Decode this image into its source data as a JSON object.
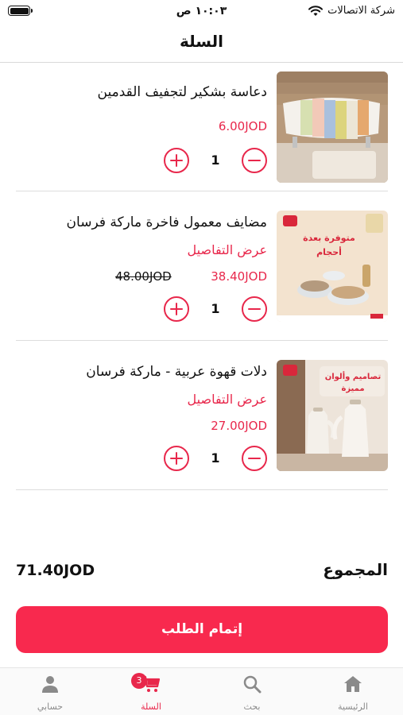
{
  "status_bar": {
    "time": "١٠:٠٣ ص",
    "carrier": "شركة الاتصالات"
  },
  "header": {
    "title": "السلة"
  },
  "cart": {
    "items": [
      {
        "name": "دعاسة بشكير لتجفيف القدمين",
        "price": "6.00JOD",
        "quantity": "1",
        "image": "bath-mat-towels-image"
      },
      {
        "name": "مضايف معمول فاخرة ماركة فرسان",
        "details_label": "عرض التفاصيل",
        "price": "38.40JOD",
        "old_price": "48.00JOD",
        "quantity": "1",
        "image": "maamoul-serving-dishes-image",
        "image_caption_line1": "متوفرة بعدة",
        "image_caption_line2": "أحجام"
      },
      {
        "name": "دلات قهوة عربية - ماركة فرسان",
        "details_label": "عرض التفاصيل",
        "price": "27.00JOD",
        "quantity": "1",
        "image": "arabic-coffee-pots-image",
        "image_caption_line1": "تصاميم وألوان",
        "image_caption_line2": "مميزة"
      }
    ]
  },
  "total": {
    "label": "المجموع",
    "value": "71.40JOD"
  },
  "checkout": {
    "label": "إتمام الطلب"
  },
  "bottom_nav": {
    "items": [
      {
        "label": "الرئيسية",
        "icon": "home-icon"
      },
      {
        "label": "بحث",
        "icon": "search-icon"
      },
      {
        "label": "السلة",
        "icon": "cart-icon",
        "badge": "3",
        "active": true
      },
      {
        "label": "حسابي",
        "icon": "user-icon"
      }
    ]
  },
  "colors": {
    "accent": "#e8274b",
    "checkout_button": "#f8294e",
    "inactive_nav": "#8a8a8a"
  }
}
